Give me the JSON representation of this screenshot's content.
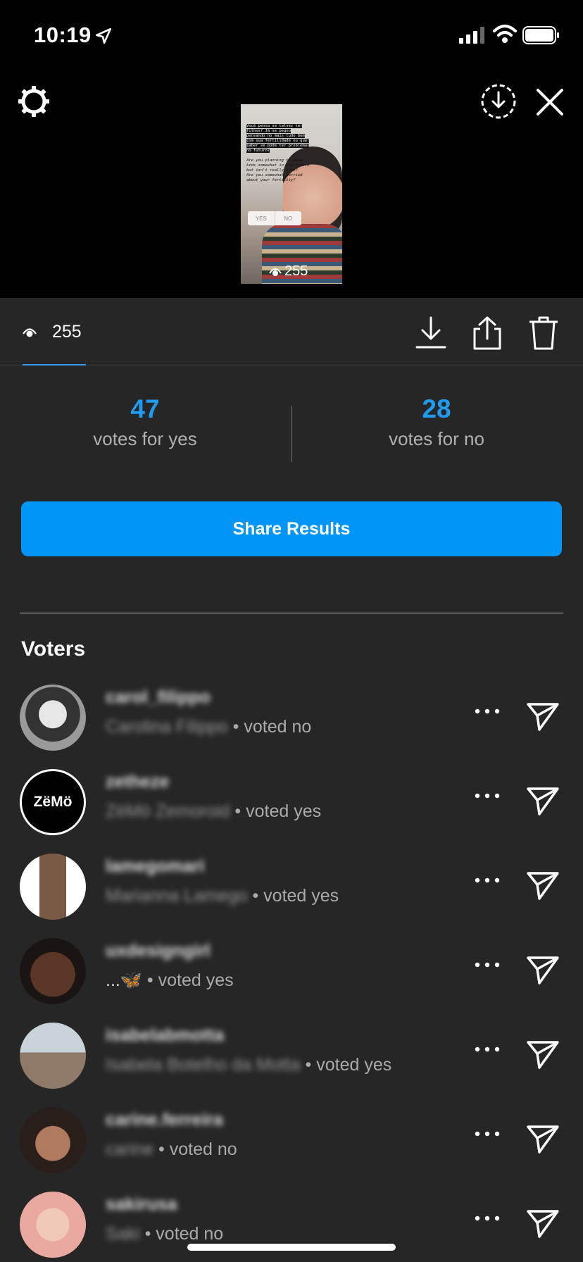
{
  "status_bar": {
    "time": "10:19"
  },
  "story_preview": {
    "text_lines": [
      "Você pensa se talvez ter",
      "filhos? Já se pegou",
      "pensando no mais tudo bem",
      "com sua fertilidade ou quer",
      "saber se pode ter problemas",
      "no futuro?"
    ],
    "text_lines_en": [
      "Are you planning to have",
      "kids somewhat in the future",
      "but isn't really sure?",
      "Are you somewhat worried",
      "about your fertility?"
    ],
    "poll_yes": "YES",
    "poll_no": "NO",
    "views": "255"
  },
  "tab_bar": {
    "views_count": "255"
  },
  "results": {
    "yes_count": "47",
    "yes_label": "votes for yes",
    "no_count": "28",
    "no_label": "votes for no"
  },
  "share_button": "Share Results",
  "voters_title": "Voters",
  "voters": [
    {
      "username": "carol_filippo",
      "full_name": "Carolina Filippo",
      "vote": "• voted no",
      "avatar": "portrait-bw"
    },
    {
      "username": "zetheze",
      "full_name": "ZëMö Zemoroid",
      "vote": "• voted yes",
      "avatar_text": "ZëMö"
    },
    {
      "username": "lamegomari",
      "full_name": "Marianna Lamego",
      "vote": "• voted yes",
      "avatar": "portrait-white"
    },
    {
      "username": "uxdesigngirl",
      "full_name": "...🦋",
      "vote": "• voted yes",
      "avatar": "portrait-dark"
    },
    {
      "username": "isabelabmotta",
      "full_name": "Isabela Botelho da Motta",
      "vote": "• voted yes",
      "avatar": "portrait-paris"
    },
    {
      "username": "carine.ferreira",
      "full_name": "carine",
      "vote": "• voted no",
      "avatar": "portrait-warm"
    },
    {
      "username": "sakirusa",
      "full_name": "Saki",
      "vote": "• voted no",
      "avatar": "portrait-pink"
    }
  ],
  "colors": {
    "accent": "#0095f6",
    "count_blue": "#1f9bf0",
    "background": "#262626",
    "top": "#000000"
  }
}
